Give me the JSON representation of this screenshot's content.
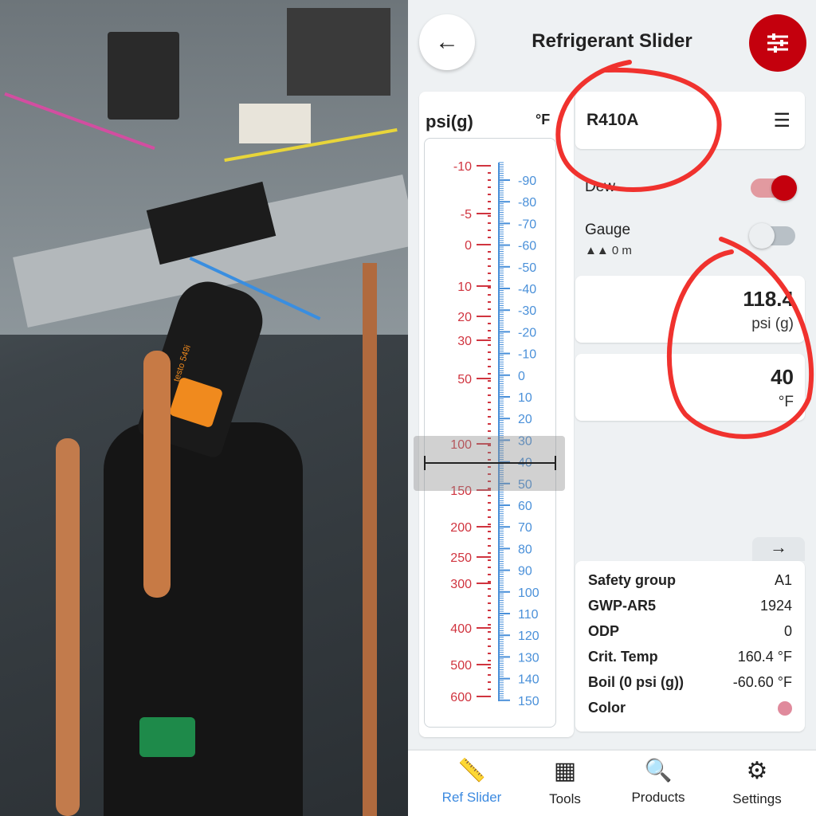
{
  "photo": {
    "label": "testo 549i",
    "description_icon": "photo-hvac-compressor"
  },
  "header": {
    "title": "Refrigerant Slider",
    "back_icon": "arrow-left-icon",
    "filter_icon": "sliders-icon"
  },
  "scale": {
    "left_unit": "psi(g)",
    "right_unit": "°F",
    "psi_ticks": [
      "-10",
      "-5",
      "0",
      "10",
      "20",
      "30",
      "50",
      "100",
      "150",
      "200",
      "250",
      "300",
      "400",
      "500",
      "600"
    ],
    "f_ticks": [
      "-90",
      "-80",
      "-70",
      "-60",
      "-50",
      "-40",
      "-30",
      "-20",
      "-10",
      "0",
      "10",
      "20",
      "30",
      "40",
      "50",
      "60",
      "70",
      "80",
      "90",
      "100",
      "110",
      "120",
      "130",
      "140",
      "150"
    ],
    "cursor_f": 40,
    "cursor_psi": 118.4
  },
  "refrigerant": {
    "name": "R410A",
    "list_icon": "list-icon"
  },
  "toggles": {
    "dew_label": "Dew",
    "dew_on": true,
    "gauge_label": "Gauge",
    "gauge_on": false,
    "altitude": "0 m"
  },
  "pressure": {
    "value": "118.4",
    "unit": "psi (g)"
  },
  "temperature": {
    "value": "40",
    "unit": "°F"
  },
  "expand_icon": "arrow-right-icon",
  "info": [
    {
      "key": "Safety group",
      "value": "A1"
    },
    {
      "key": "GWP-AR5",
      "value": "1924"
    },
    {
      "key": "ODP",
      "value": "0"
    },
    {
      "key": "Crit. Temp",
      "value": "160.4 °F"
    },
    {
      "key": "Boil (0 psi (g))",
      "value": "-60.60 °F"
    },
    {
      "key": "Color",
      "value": "",
      "swatch": "#e08a9c"
    }
  ],
  "nav": [
    {
      "label": "Ref Slider",
      "active": true
    },
    {
      "label": "Tools"
    },
    {
      "label": "Products"
    },
    {
      "label": "Settings"
    }
  ],
  "colors": {
    "accent": "#c4000d",
    "blue": "#4a90d9",
    "psi_red": "#d0343f"
  }
}
